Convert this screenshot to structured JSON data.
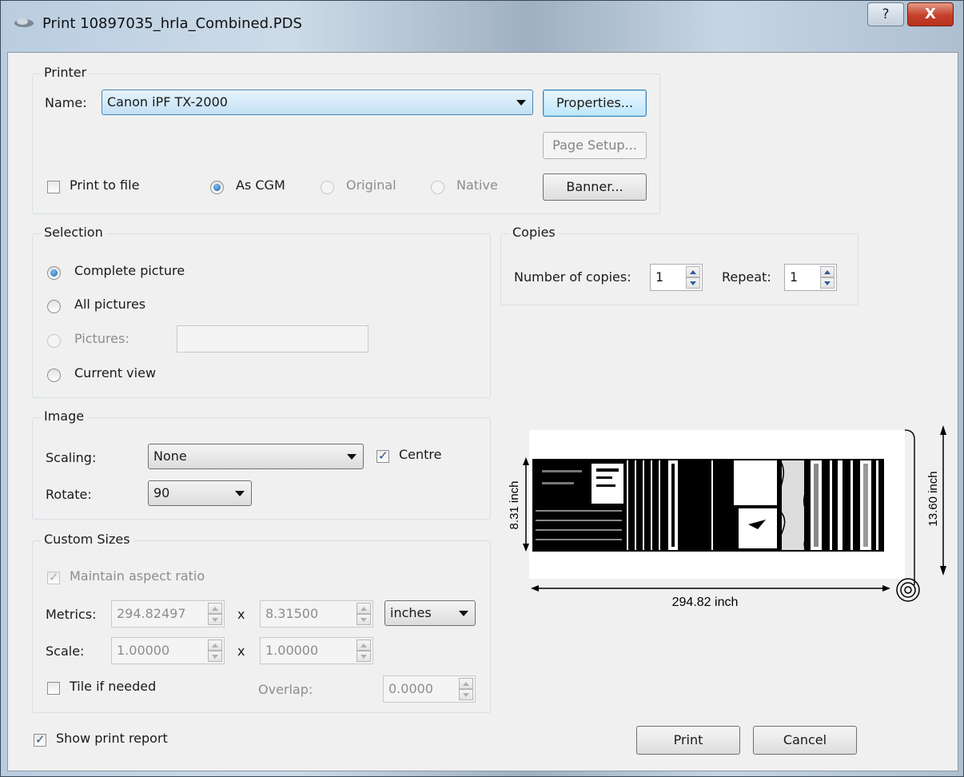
{
  "window": {
    "title": "Print 10897035_hrla_Combined.PDS",
    "help_glyph": "?",
    "close_glyph": "X"
  },
  "printer": {
    "group_title": "Printer",
    "name_label": "Name:",
    "name_value": "Canon iPF TX-2000",
    "properties_button": "Properties...",
    "page_setup_button": "Page Setup...",
    "print_to_file_label": "Print to file",
    "print_to_file_checked": false,
    "format_options": [
      {
        "label": "As CGM",
        "selected": true,
        "enabled": true
      },
      {
        "label": "Original",
        "selected": false,
        "enabled": false
      },
      {
        "label": "Native",
        "selected": false,
        "enabled": false
      }
    ],
    "banner_button": "Banner..."
  },
  "selection": {
    "group_title": "Selection",
    "options": [
      {
        "label": "Complete picture",
        "selected": true,
        "enabled": true
      },
      {
        "label": "All pictures",
        "selected": false,
        "enabled": true
      },
      {
        "label": "Pictures:",
        "selected": false,
        "enabled": false
      },
      {
        "label": "Current view",
        "selected": false,
        "enabled": true
      }
    ],
    "pictures_value": ""
  },
  "copies": {
    "group_title": "Copies",
    "number_label": "Number of copies:",
    "number_value": "1",
    "repeat_label": "Repeat:",
    "repeat_value": "1"
  },
  "image": {
    "group_title": "Image",
    "scaling_label": "Scaling:",
    "scaling_value": "None",
    "centre_label": "Centre",
    "centre_checked": true,
    "rotate_label": "Rotate:",
    "rotate_value": "90"
  },
  "custom_sizes": {
    "group_title": "Custom Sizes",
    "maintain_label": "Maintain aspect ratio",
    "maintain_checked": true,
    "metrics_label": "Metrics:",
    "metrics_width": "294.82497",
    "metrics_height": "8.31500",
    "times": "x",
    "units_value": "inches",
    "scale_label": "Scale:",
    "scale_x": "1.00000",
    "scale_y": "1.00000",
    "tile_label": "Tile if needed",
    "tile_checked": false,
    "overlap_label": "Overlap:",
    "overlap_value": "0.0000"
  },
  "preview": {
    "width_label": "294.82 inch",
    "height_label": "8.31 inch",
    "roll_label": "13.60 inch"
  },
  "footer": {
    "show_report_label": "Show print report",
    "show_report_checked": true,
    "print_button": "Print",
    "cancel_button": "Cancel"
  }
}
